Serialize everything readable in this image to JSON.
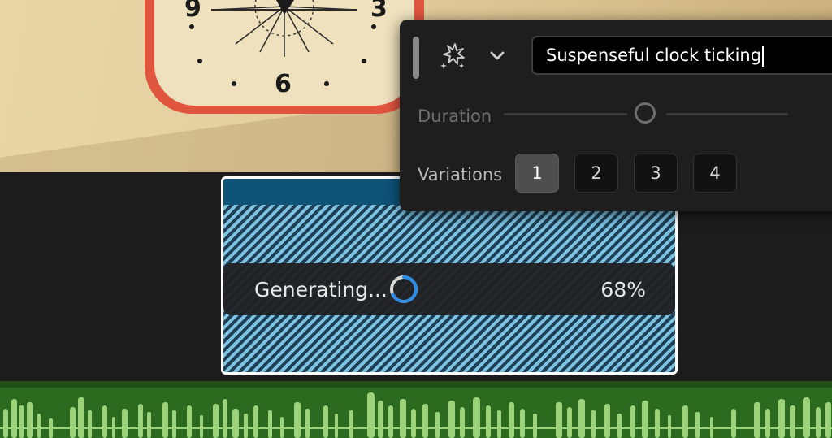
{
  "clock": {
    "numbers": [
      "9",
      "3",
      "6"
    ]
  },
  "clip": {
    "status": "Generating...",
    "progress_text": "68%",
    "progress": 0.68
  },
  "panel": {
    "prompt_value": "Suspenseful clock ticking",
    "duration_label": "Duration",
    "duration_level": 0.5,
    "variations_label": "Variations",
    "variations": [
      "1",
      "2",
      "3",
      "4"
    ],
    "selected_variation": "1"
  },
  "icons": {
    "magic": "magic-sparkle-icon",
    "chevron": "chevron-down-icon"
  },
  "colors": {
    "accent": "#2e8de6",
    "clip_stripe": "#7fc3e3",
    "clip_header": "#0e5478",
    "audio": "#2c6a1f",
    "waveform": "#9bd27a"
  }
}
